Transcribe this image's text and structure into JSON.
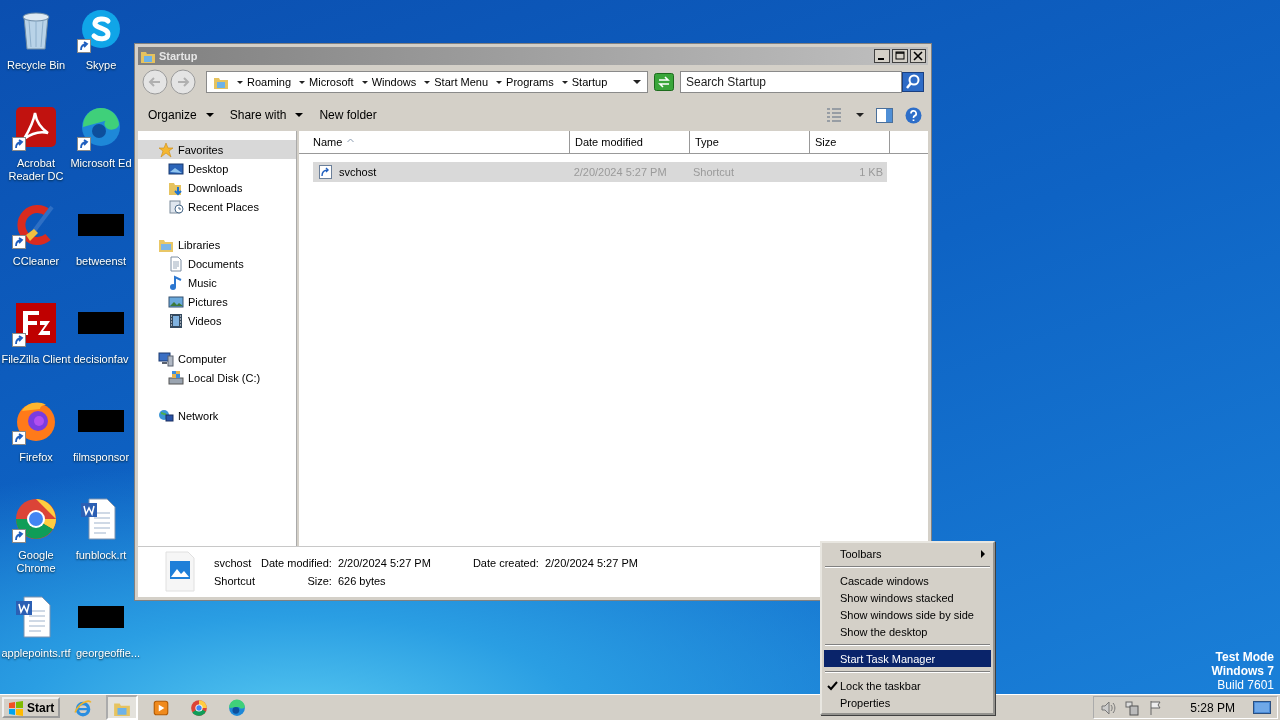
{
  "desktop": {
    "icons": [
      {
        "label": "Recycle Bin",
        "kind": "bin",
        "shortcut": false
      },
      {
        "label": "Skype",
        "kind": "skype",
        "shortcut": true
      },
      {
        "label": "Acrobat Reader DC",
        "kind": "acrobat",
        "shortcut": true
      },
      {
        "label": "Microsoft Ed",
        "kind": "edge",
        "shortcut": true
      },
      {
        "label": "CCleaner",
        "kind": "ccleaner",
        "shortcut": true
      },
      {
        "label": "betweenst",
        "kind": "redacted",
        "shortcut": false
      },
      {
        "label": "FileZilla Client",
        "kind": "filezilla",
        "shortcut": true
      },
      {
        "label": "decisionfav",
        "kind": "redacted",
        "shortcut": false
      },
      {
        "label": "Firefox",
        "kind": "firefox",
        "shortcut": true
      },
      {
        "label": "filmsponsor",
        "kind": "redacted",
        "shortcut": false
      },
      {
        "label": "Google Chrome",
        "kind": "chrome",
        "shortcut": true
      },
      {
        "label": "funblock.rt",
        "kind": "doc",
        "shortcut": false
      },
      {
        "label": "applepoints.rtf",
        "kind": "doc",
        "shortcut": false
      },
      {
        "label": "georgeoffie...",
        "kind": "redacted",
        "shortcut": false
      }
    ],
    "edition": [
      "Test Mode",
      "Windows 7",
      "Build 7601"
    ]
  },
  "window": {
    "title": "Startup",
    "breadcrumbs": [
      "Roaming",
      "Microsoft",
      "Windows",
      "Start Menu",
      "Programs",
      "Startup"
    ],
    "search": {
      "placeholder": "Search Startup"
    },
    "toolbar": [
      {
        "label": "Organize",
        "dropdown": true
      },
      {
        "label": "Share with",
        "dropdown": true
      },
      {
        "label": "New folder",
        "dropdown": false
      }
    ],
    "nav": [
      {
        "label": "Favorites",
        "kind": "star",
        "selected": true,
        "children": [
          {
            "label": "Desktop",
            "kind": "desktop",
            "selected": false
          },
          {
            "label": "Downloads",
            "kind": "downloads",
            "selected": false
          },
          {
            "label": "Recent Places",
            "kind": "recent",
            "selected": false
          }
        ]
      },
      {
        "label": "Libraries",
        "kind": "libraries",
        "selected": false,
        "children": [
          {
            "label": "Documents",
            "kind": "documents",
            "selected": false
          },
          {
            "label": "Music",
            "kind": "music",
            "selected": false
          },
          {
            "label": "Pictures",
            "kind": "pictures",
            "selected": false
          },
          {
            "label": "Videos",
            "kind": "videos",
            "selected": false
          }
        ]
      },
      {
        "label": "Computer",
        "kind": "computer",
        "selected": false,
        "children": [
          {
            "label": "Local Disk (C:)",
            "kind": "disk",
            "selected": false
          }
        ]
      },
      {
        "label": "Network",
        "kind": "network",
        "selected": false
      }
    ],
    "columns": [
      {
        "label": "Name",
        "sorted": true
      },
      {
        "label": "Date modified",
        "sorted": false
      },
      {
        "label": "Type",
        "sorted": false
      },
      {
        "label": "Size",
        "sorted": false
      }
    ],
    "rows": [
      {
        "name": "svchost",
        "date_modified": "2/20/2024 5:27 PM",
        "type": "Shortcut",
        "size": "1 KB",
        "selected": true
      }
    ],
    "details": {
      "name": "svchost",
      "type": "Shortcut",
      "fields": [
        {
          "label": "Date modified:",
          "value": "2/20/2024 5:27 PM"
        },
        {
          "label": "Size:",
          "value": "626 bytes"
        },
        {
          "label": "Date created:",
          "value": "2/20/2024 5:27 PM"
        }
      ]
    }
  },
  "context_menu": [
    {
      "kind": "item",
      "label": "Toolbars",
      "submenu": true,
      "checked": false,
      "selected": false
    },
    {
      "kind": "separator"
    },
    {
      "kind": "item",
      "label": "Cascade windows",
      "submenu": false,
      "checked": false,
      "selected": false
    },
    {
      "kind": "item",
      "label": "Show windows stacked",
      "submenu": false,
      "checked": false,
      "selected": false
    },
    {
      "kind": "item",
      "label": "Show windows side by side",
      "submenu": false,
      "checked": false,
      "selected": false
    },
    {
      "kind": "item",
      "label": "Show the desktop",
      "submenu": false,
      "checked": false,
      "selected": false
    },
    {
      "kind": "separator"
    },
    {
      "kind": "item",
      "label": "Start Task Manager",
      "submenu": false,
      "checked": false,
      "selected": true
    },
    {
      "kind": "separator"
    },
    {
      "kind": "item",
      "label": "Lock the taskbar",
      "submenu": false,
      "checked": true,
      "selected": false
    },
    {
      "kind": "item",
      "label": "Properties",
      "submenu": false,
      "checked": false,
      "selected": false
    }
  ],
  "taskbar": {
    "start": "Start",
    "apps": [
      {
        "kind": "ie",
        "active": false
      },
      {
        "kind": "explorer",
        "active": true
      },
      {
        "kind": "media",
        "active": false
      },
      {
        "kind": "chrome",
        "active": false
      },
      {
        "kind": "edge",
        "active": false
      }
    ],
    "clock": "5:28 PM"
  }
}
